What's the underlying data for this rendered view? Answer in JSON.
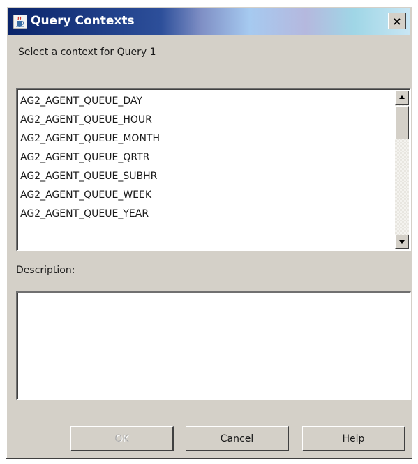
{
  "window": {
    "title": "Query Contexts",
    "close_label": "×"
  },
  "prompt": "Select a context for Query 1",
  "contexts": {
    "items": [
      "AG2_AGENT_QUEUE_DAY",
      "AG2_AGENT_QUEUE_HOUR",
      "AG2_AGENT_QUEUE_MONTH",
      "AG2_AGENT_QUEUE_QRTR",
      "AG2_AGENT_QUEUE_SUBHR",
      "AG2_AGENT_QUEUE_WEEK",
      "AG2_AGENT_QUEUE_YEAR"
    ]
  },
  "description": {
    "label": "Description:",
    "value": ""
  },
  "buttons": {
    "ok": "OK",
    "cancel": "Cancel",
    "help": "Help"
  },
  "icons": {
    "title_icon": "java-cup-icon",
    "close": "close-icon",
    "scroll_up": "arrow-up-icon",
    "scroll_down": "arrow-down-icon"
  },
  "colors": {
    "window_bg": "#d4d0c8",
    "titlebar_start": "#0a246a",
    "disabled_text": "#a8a8a8"
  }
}
